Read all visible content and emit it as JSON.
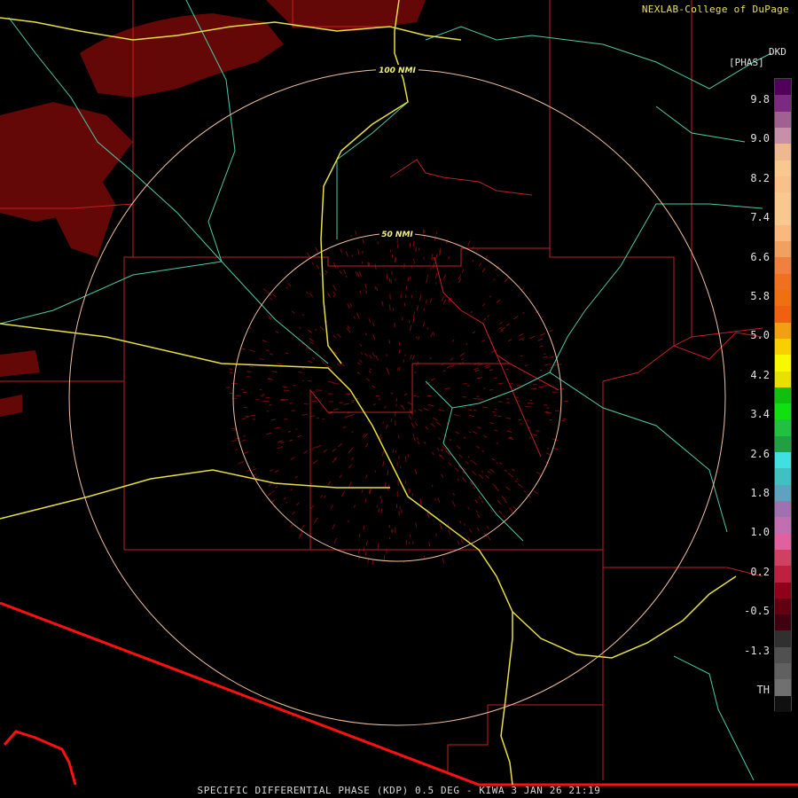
{
  "credit": "NEXLAB-College of DuPage",
  "legend": {
    "product": "DKD",
    "unit": "[PHAS]",
    "ticks": [
      "9.8",
      "9.0",
      "8.2",
      "7.4",
      "6.6",
      "5.8",
      "5.0",
      "4.2",
      "3.4",
      "2.6",
      "1.8",
      "1.0",
      "0.2",
      "-0.5",
      "-1.3",
      "TH"
    ]
  },
  "range_rings": [
    "100 NMI",
    "50 NMI"
  ],
  "caption": "SPECIFIC DIFFERENTIAL PHASE (KDP) 0.5 DEG - KIWA 3 JAN 26 21:19",
  "colors": {
    "county": "#c02020",
    "border": "#ff1010",
    "highway": "#e8e040",
    "route": "#50c8a8",
    "ring": "#f0c0a0",
    "echo": "#7a0a0a"
  }
}
